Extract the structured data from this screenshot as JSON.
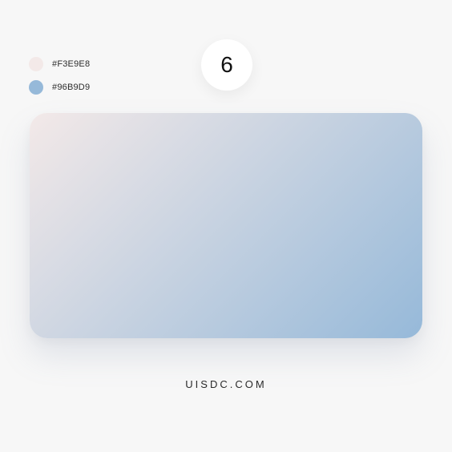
{
  "palette": {
    "number": "6",
    "colors": [
      {
        "hex": "#F3E9E8",
        "label": "#F3E9E8"
      },
      {
        "hex": "#96B9D9",
        "label": "#96B9D9"
      }
    ]
  },
  "card": {
    "gradient_start": "#F3E9E8",
    "gradient_end": "#96B9D9"
  },
  "footer": {
    "watermark": "UISDC.COM"
  }
}
